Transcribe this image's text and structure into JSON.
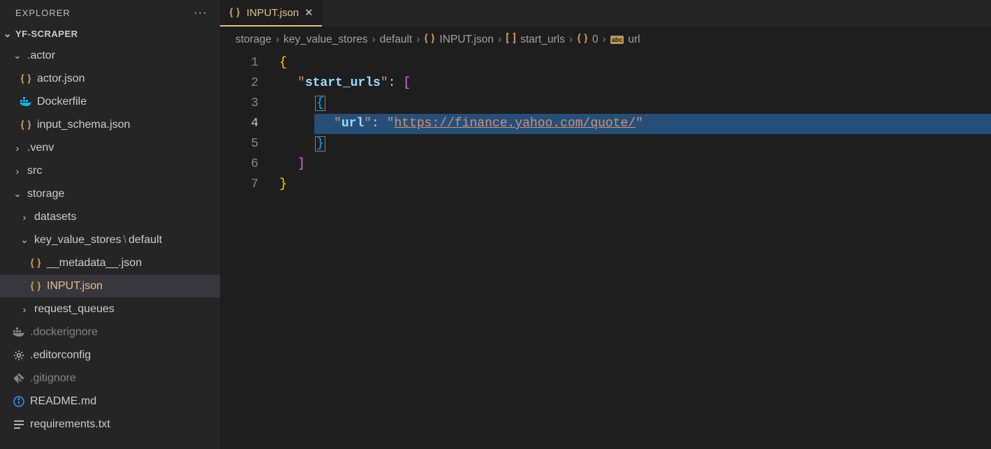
{
  "explorer": {
    "title": "EXPLORER",
    "project": "YF-SCRAPER"
  },
  "tree": {
    "actor": ".actor",
    "actor_json": "actor.json",
    "dockerfile": "Dockerfile",
    "input_schema": "input_schema.json",
    "venv": ".venv",
    "src": "src",
    "storage": "storage",
    "datasets": "datasets",
    "kvs": "key_value_stores",
    "kvs_default": "default",
    "metadata": "__metadata__.json",
    "input_json": "INPUT.json",
    "request_queues": "request_queues",
    "dockerignore": ".dockerignore",
    "editorconfig": ".editorconfig",
    "gitignore": ".gitignore",
    "readme": "README.md",
    "requirements": "requirements.txt"
  },
  "tab": {
    "name": "INPUT.json"
  },
  "breadcrumb": {
    "s1": "storage",
    "s2": "key_value_stores",
    "s3": "default",
    "s4": "INPUT.json",
    "s5": "start_urls",
    "s6": "0",
    "s7": "url"
  },
  "code": {
    "line_numbers": [
      "1",
      "2",
      "3",
      "4",
      "5",
      "6",
      "7"
    ],
    "key_start_urls": "start_urls",
    "key_url": "url",
    "url_value": "https://finance.yahoo.com/quote/"
  }
}
